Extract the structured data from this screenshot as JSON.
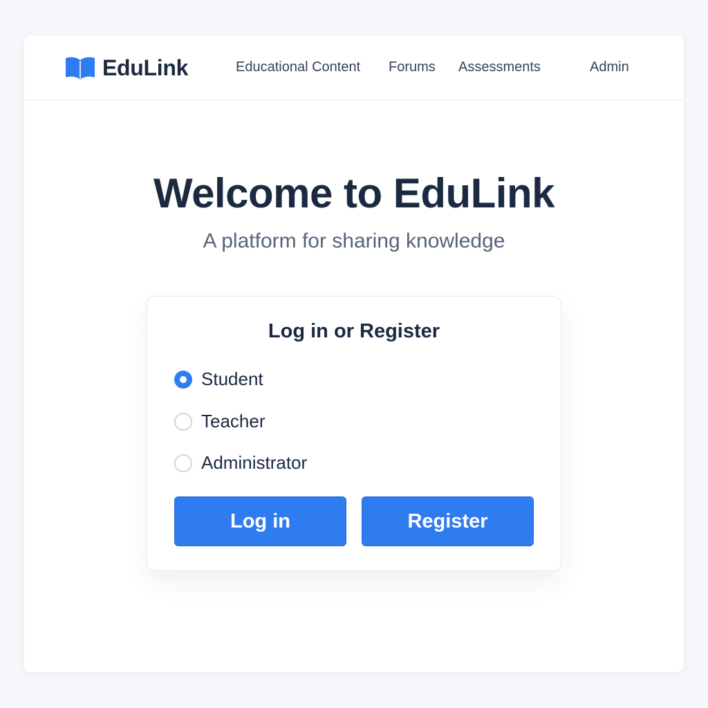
{
  "header": {
    "brand": {
      "name": "EduLink",
      "icon": "open-book-icon"
    },
    "nav": [
      {
        "label": "Educational Content"
      },
      {
        "label": "Forums"
      },
      {
        "label": "Assessments"
      },
      {
        "label": "Admin"
      }
    ]
  },
  "hero": {
    "title": "Welcome to EduLink",
    "subtitle": "A platform for sharing knowledge"
  },
  "auth_card": {
    "title": "Log in or Register",
    "roles": [
      {
        "label": "Student",
        "selected": true
      },
      {
        "label": "Teacher",
        "selected": false
      },
      {
        "label": "Administrator",
        "selected": false
      }
    ],
    "login_label": "Log in",
    "register_label": "Register"
  },
  "colors": {
    "accent": "#2f7cf0",
    "heading": "#1b2a41",
    "subtle_text": "#566479",
    "page_background": "#f6f7fa"
  }
}
